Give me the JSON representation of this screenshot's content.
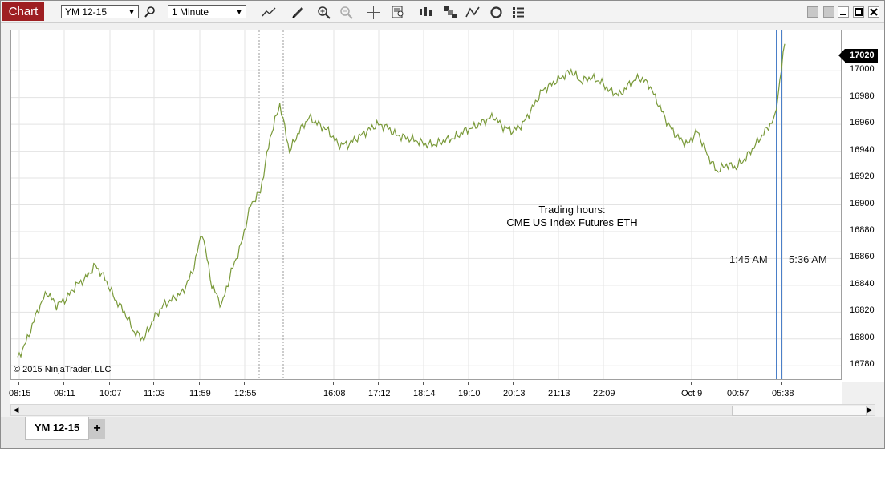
{
  "toolbar": {
    "app_title": "Chart",
    "instrument": "YM 12-15",
    "interval": "1 Minute",
    "icons": [
      "search-icon",
      "line-chart-icon",
      "pencil-icon",
      "zoom-in-icon",
      "zoom-out-icon",
      "crosshair-icon",
      "data-box-icon",
      "bar-style-icon",
      "chart-style-icon",
      "drawing-tools-icon",
      "reload-icon",
      "properties-icon"
    ]
  },
  "window_buttons": [
    "minimize-icon",
    "restore-icon",
    "maximize-icon",
    "close-icon"
  ],
  "chart": {
    "last_price": "17020",
    "copyright": "© 2015 NinjaTrader, LLC",
    "trading_hours_line1": "Trading hours:",
    "trading_hours_line2": "CME US Index Futures ETH",
    "session_start_label": "1:45 AM",
    "session_end_label": "5:36 AM",
    "colors": {
      "price_line": "#7a9a3a",
      "session_lines": "#4a7fc8",
      "price_tag_bg": "#000000",
      "title_bg": "#9e1f22"
    }
  },
  "chart_data": {
    "type": "line",
    "series": [
      {
        "values": [
          16785,
          16800,
          16820,
          16835,
          16825,
          16830,
          16840,
          16845,
          16855,
          16845,
          16830,
          16820,
          16805,
          16800,
          16815,
          16825,
          16830,
          16835,
          16850,
          16880,
          16840,
          16825,
          16850,
          16870,
          16900,
          16910,
          16950,
          16975,
          16940,
          16955,
          16965,
          16960,
          16955,
          16945,
          16945,
          16950,
          16955,
          16960,
          16958,
          16952,
          16950,
          16948,
          16945,
          16945,
          16948,
          16950,
          16955,
          16958,
          16962,
          16966,
          16958,
          16955,
          16960,
          16972,
          16985,
          16990,
          16995,
          17000,
          16992,
          16995,
          16992,
          16985,
          16982,
          16990,
          16995,
          16990,
          16975,
          16960,
          16950,
          16945,
          16955,
          16938,
          16925,
          16930,
          16928,
          16935,
          16945,
          16955,
          16965,
          17020
        ]
      }
    ],
    "ylim": [
      16770,
      17030
    ],
    "yticks": [
      "16780",
      "16800",
      "16820",
      "16840",
      "16860",
      "16880",
      "16900",
      "16920",
      "16940",
      "16960",
      "16980",
      "17000"
    ],
    "xticks": [
      "08:15",
      "09:11",
      "10:07",
      "11:03",
      "11:59",
      "12:55",
      "16:08",
      "17:12",
      "18:14",
      "19:10",
      "20:13",
      "21:13",
      "22:09",
      "Oct 9",
      "00:57",
      "05:38"
    ],
    "grid": true
  },
  "tabs": {
    "active": "YM 12-15",
    "add_label": "+"
  }
}
